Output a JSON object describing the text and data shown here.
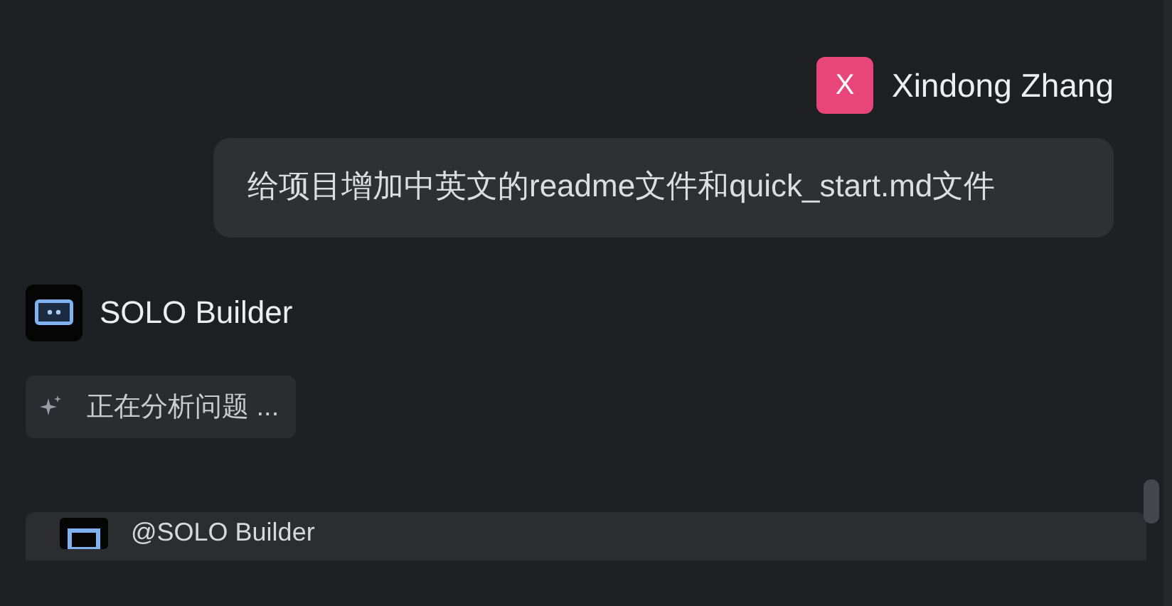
{
  "user_message": {
    "avatar_letter": "X",
    "author": "Xindong Zhang",
    "text": "给项目增加中英文的readme文件和quick_start.md文件"
  },
  "assistant": {
    "name": "SOLO Builder",
    "status": "正在分析问题 ..."
  },
  "next_card": {
    "title": "@SOLO Builder"
  }
}
